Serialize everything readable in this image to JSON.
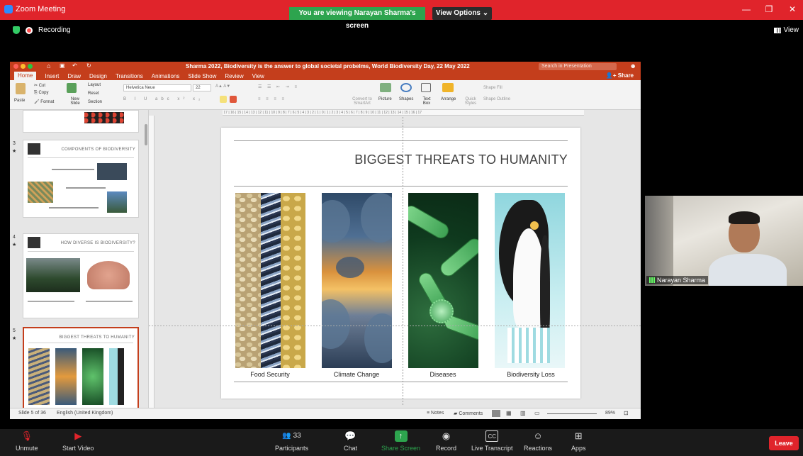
{
  "zoom": {
    "app_title": "Zoom Meeting",
    "viewing_banner": "You are viewing Narayan Sharma's screen",
    "view_options": "View Options ⌄",
    "recording": "Recording",
    "view_label": "View",
    "colors": {
      "titlebar": "#e0242b",
      "banner": "#2da44e",
      "leave": "#e0242b"
    }
  },
  "ppt": {
    "doc_title": "Sharma 2022, Biodiversity is the answer to global societal probelms, World Biodiversity Day, 22 May 2022",
    "search_placeholder": "Search in Presentation",
    "share_label": "Share",
    "tabs": [
      "Home",
      "Insert",
      "Draw",
      "Design",
      "Transitions",
      "Animations",
      "Slide Show",
      "Review",
      "View"
    ],
    "ribbon": {
      "paste": "Paste",
      "cut": "Cut",
      "copy": "Copy",
      "format": "Format",
      "new_slide": "New Slide",
      "layout": "Layout",
      "reset": "Reset",
      "section": "Section",
      "font": "Helvetica Neue",
      "font_size": "22",
      "convert_smartart": "Convert to SmartArt",
      "picture": "Picture",
      "shapes": "Shapes",
      "text_box": "Text Box",
      "arrange": "Arrange",
      "quick_styles": "Quick Styles",
      "shape_fill": "Shape Fill",
      "shape_outline": "Shape Outline"
    },
    "thumbnails": [
      {
        "num": "3",
        "title": "COMPONENTS OF BIODIVERSITY"
      },
      {
        "num": "4",
        "title": "HOW DIVERSE IS BIODIVERSITY?"
      },
      {
        "num": "5",
        "title": "BIGGEST THREATS TO HUMANITY"
      }
    ],
    "slide": {
      "title": "BIGGEST THREATS TO HUMANITY",
      "panels": [
        "Food Security",
        "Climate Change",
        "Diseases",
        "Biodiversity Loss"
      ]
    },
    "status": {
      "slide_of": "Slide 5 of 36",
      "language": "English (United Kingdom)",
      "notes": "Notes",
      "comments": "Comments",
      "zoom": "89%"
    }
  },
  "speaker": {
    "name": "Narayan Sharma"
  },
  "toolbar": {
    "unmute": "Unmute",
    "start_video": "Start Video",
    "participants": "Participants",
    "participants_count": "33",
    "chat": "Chat",
    "share_screen": "Share Screen",
    "record": "Record",
    "live_transcript": "Live Transcript",
    "reactions": "Reactions",
    "apps": "Apps",
    "leave": "Leave"
  }
}
